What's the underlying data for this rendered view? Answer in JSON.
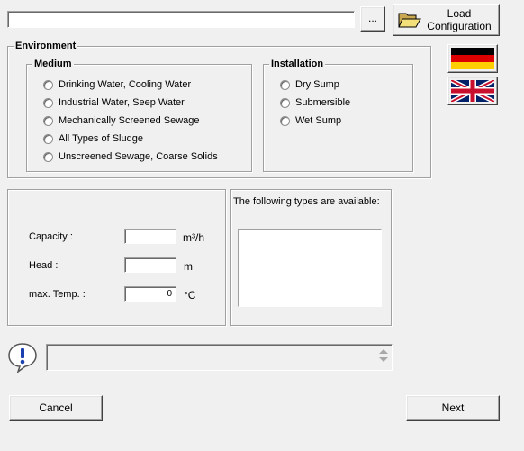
{
  "path_input": {
    "value": ""
  },
  "browse_button": {
    "label": "..."
  },
  "load_button": {
    "label_line1": "Load",
    "label_line2": "Configuration"
  },
  "environment": {
    "title": "Environment",
    "medium": {
      "title": "Medium",
      "options": [
        "Drinking Water, Cooling Water",
        "Industrial Water, Seep Water",
        "Mechanically Screened Sewage",
        "All Types of Sludge",
        "Unscreened Sewage, Coarse Solids"
      ]
    },
    "installation": {
      "title": "Installation",
      "options": [
        "Dry Sump",
        "Submersible",
        "Wet Sump"
      ]
    }
  },
  "languages": {
    "german": "flag-de",
    "english": "flag-uk"
  },
  "parameters": {
    "capacity": {
      "label": "Capacity :",
      "value": "",
      "unit": "m³/h"
    },
    "head": {
      "label": "Head :",
      "value": "",
      "unit": "m"
    },
    "temp": {
      "label": "max. Temp. :",
      "value": "0",
      "unit": "°C"
    }
  },
  "types": {
    "title": "The following types are available:"
  },
  "message": {
    "icon": "info-bubble-icon",
    "text": ""
  },
  "buttons": {
    "cancel": "Cancel",
    "next": "Next"
  }
}
